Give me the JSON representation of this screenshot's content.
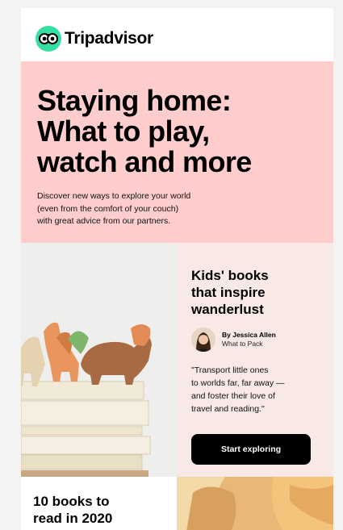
{
  "brand": {
    "name": "Tripadvisor",
    "logo_icon": "owl-eyes-icon",
    "logo_color": "#34e0a1"
  },
  "hero": {
    "title_lines": [
      "Staying home:",
      "What to play,",
      "watch and more"
    ],
    "description_lines": [
      "Discover new ways to explore your world",
      "(even from the comfort of your couch)",
      "with great advice from our partners."
    ],
    "background": "#ffcdcc"
  },
  "feature": {
    "image_icon": "toy-dinosaurs-on-books-image",
    "title_lines": [
      "Kids' books",
      "that inspire",
      "wanderlust"
    ],
    "author": {
      "name": "By Jessica Allen",
      "role": "What to Pack"
    },
    "quote_lines": [
      "\"Transport little ones",
      "to worlds far, far away —",
      "and foster their love of",
      "travel and reading.\""
    ],
    "cta_label": "Start exploring",
    "background": "#f8e9e7"
  },
  "bottom": {
    "title_lines": [
      "10 books to",
      "read in 2020"
    ],
    "image_icon": "child-reading-image"
  }
}
